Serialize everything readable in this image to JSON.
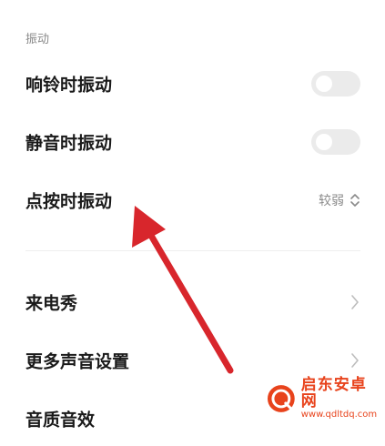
{
  "section": {
    "title": "振动"
  },
  "rows": [
    {
      "label": "响铃时振动",
      "control": "toggle",
      "on": false
    },
    {
      "label": "静音时振动",
      "control": "toggle",
      "on": false
    },
    {
      "label": "点按时振动",
      "control": "select",
      "value": "较弱"
    },
    {
      "label": "来电秀",
      "control": "chevron"
    },
    {
      "label": "更多声音设置",
      "control": "chevron"
    },
    {
      "label": "音质音效",
      "control": "chevron"
    }
  ],
  "icons": {
    "toggle": "toggle-switch",
    "select": "up-down-chevron-icon",
    "chevron": "chevron-right-icon"
  },
  "colors": {
    "annotation_arrow": "#d8262c",
    "toggle_off": "#ebebeb",
    "secondary_text": "#8a8a8a",
    "watermark": "#e8431c"
  },
  "watermark": {
    "name": "启东安卓网",
    "url": "www.qdltdq.com"
  }
}
